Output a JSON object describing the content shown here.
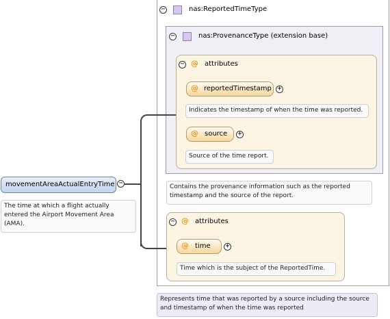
{
  "reported_time_type": {
    "title": "nas:ReportedTimeType",
    "documentation": "Represents time that was reported by a source including the source and timestamp of when the time was reported"
  },
  "provenance_type": {
    "title": "nas:ProvenanceType (extension base)",
    "documentation": "Contains the provenance information such as the reported timestamp and the source of the report."
  },
  "provenance_attributes": {
    "label": "attributes",
    "items": [
      {
        "name": "reportedTimestamp",
        "documentation": "Indicates the timestamp of when the time was reported."
      },
      {
        "name": "source",
        "documentation": "Source of the time report."
      }
    ]
  },
  "own_attributes": {
    "label": "attributes",
    "items": [
      {
        "name": "time",
        "documentation": "Time which is the subject of the ReportedTime."
      }
    ]
  },
  "element": {
    "name": "movementAreaActualEntryTime",
    "documentation": "The time at which a flight actually entered the Airport Movement Area (AMA)."
  },
  "symbols": {
    "collapse": "−",
    "expand": "+",
    "attribute": "@"
  }
}
